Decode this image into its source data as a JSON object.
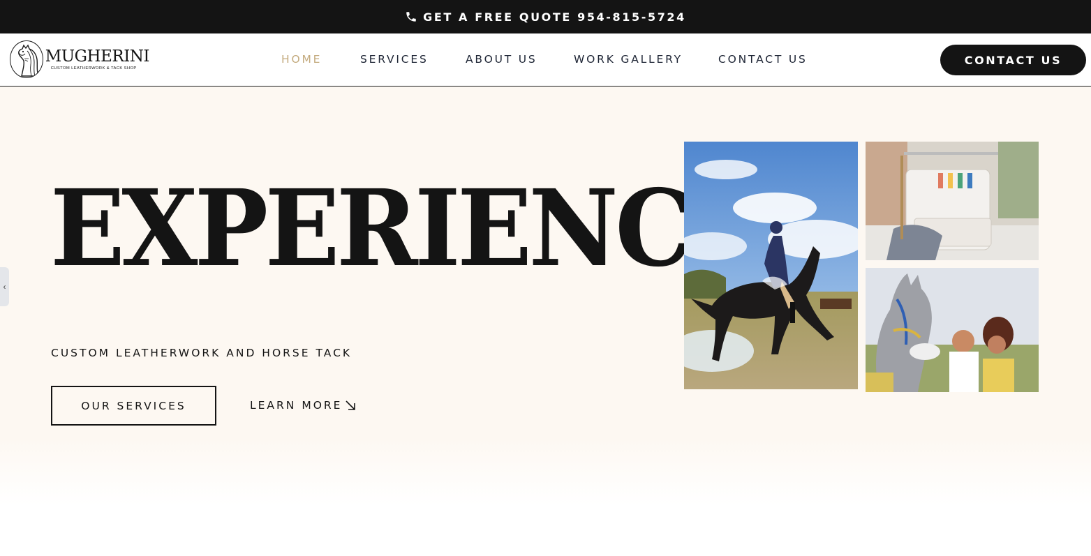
{
  "topbar": {
    "icon": "phone-icon",
    "quote_text": "GET A FREE QUOTE 954-815-5724"
  },
  "header": {
    "logo": {
      "icon": "horse-head-icon",
      "name": "MUGHERINI",
      "tagline": "CUSTOM LEATHERWORK & TACK SHOP"
    },
    "nav": [
      {
        "label": "HOME",
        "active": true
      },
      {
        "label": "SERVICES",
        "active": false
      },
      {
        "label": "ABOUT US",
        "active": false
      },
      {
        "label": "WORK GALLERY",
        "active": false
      },
      {
        "label": "CONTACT US",
        "active": false
      }
    ],
    "cta_label": "CONTACT US"
  },
  "hero": {
    "side_tab_icon": "chevron-left-icon",
    "title": "EXPERIENCE",
    "subtitle": "CUSTOM LEATHERWORK AND HORSE TACK",
    "primary_button": "OUR SERVICES",
    "secondary_link": "LEARN MORE",
    "secondary_link_icon": "arrow-down-right-icon"
  },
  "colors": {
    "topbar_bg": "#141414",
    "nav_active": "#c4ab7e",
    "nav_text": "#1e2535",
    "hero_bg": "#fdf8f2"
  }
}
